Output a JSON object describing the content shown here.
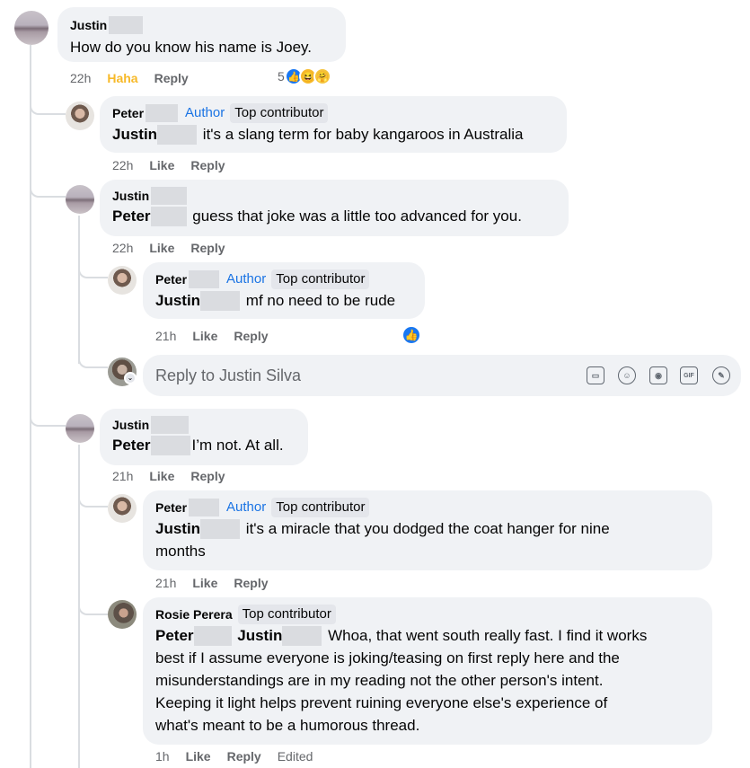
{
  "labels": {
    "author": "Author",
    "top_contributor": "Top contributor",
    "like": "Like",
    "reply": "Reply",
    "haha": "Haha",
    "edited": "Edited"
  },
  "comments": [
    {
      "id": "c1",
      "name": "Justin",
      "text": "How do you know his name is Joey.",
      "time": "22h",
      "reaction_count": "5",
      "reactions": [
        "like-icon",
        "haha-icon",
        "care-icon"
      ]
    },
    {
      "id": "c2",
      "name": "Peter",
      "mention": "Justin",
      "text": "it's a slang term for baby kangaroos in Australia",
      "time": "22h"
    },
    {
      "id": "c3",
      "name": "Justin",
      "mention": "Peter",
      "text": "guess that joke was a little too advanced for you.",
      "time": "22h"
    },
    {
      "id": "c4",
      "name": "Peter",
      "mention": "Justin",
      "text": "mf no need to be rude",
      "time": "21h",
      "reactions": [
        "like-icon"
      ]
    },
    {
      "id": "c5",
      "name": "Justin",
      "mention": "Peter",
      "text": "I’m not. At all.",
      "time": "21h"
    },
    {
      "id": "c6",
      "name": "Peter",
      "mention": "Justin",
      "text": "it's a miracle that you dodged the coat hanger for nine",
      "text2": "months",
      "time": "21h"
    },
    {
      "id": "c7",
      "name": "Rosie Perera",
      "mention": "Peter",
      "mention2": "Justin",
      "text": "Whoa, that went south really fast. I find it works",
      "lines": [
        "best if I assume everyone is joking/teasing on first reply here and the",
        "misunderstandings are in my reading not the other person's intent.",
        "Keeping it light helps prevent ruining everyone else's experience of",
        "what's meant to be a humorous thread."
      ],
      "time": "1h"
    }
  ],
  "reply_box": {
    "placeholder": "Reply to Justin Silva",
    "tools": [
      "sticker-icon",
      "emoji-icon",
      "camera-icon",
      "gif-icon",
      "sticker-face-icon"
    ],
    "gif_label": "GIF"
  },
  "colors": {
    "bubble": "#f0f2f5",
    "author": "#1b74e4",
    "haha": "#f7b928",
    "like": "#1877f2",
    "meta": "#65676b"
  }
}
